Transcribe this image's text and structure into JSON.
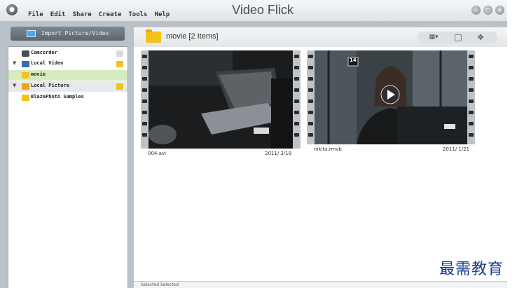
{
  "window": {
    "title": "Video Flick",
    "menu": [
      "File",
      "Edit",
      "Share",
      "Create",
      "Tools",
      "Help"
    ],
    "controls": [
      "minimize-icon",
      "maximize-icon",
      "close-icon"
    ]
  },
  "sidebar": {
    "import_button": "Import Picture/Video",
    "tree": [
      {
        "label": "Camcorder",
        "icon": "camcorder-icon"
      },
      {
        "label": "Local Video",
        "icon": "video-folder-icon"
      },
      {
        "label": "movie",
        "icon": "folder-icon",
        "selected": true
      },
      {
        "label": "Local Picture",
        "icon": "picture-folder-icon"
      },
      {
        "label": "BlazePhoto Samples",
        "icon": "folder-icon"
      }
    ]
  },
  "main": {
    "folder_label": "movie [2 Items]",
    "view_controls": [
      "grid-view-icon",
      "single-view-icon",
      "fullscreen-icon"
    ],
    "items": [
      {
        "name": "004.avi",
        "date": "2011/ 3/18"
      },
      {
        "name": "nikita.rmvb",
        "date": "2011/ 1/21",
        "badge": "14"
      }
    ],
    "status": "Selected Selected"
  },
  "watermark": "最需教育",
  "colors": {
    "app_bg": "#b9c1c9",
    "selected_row": "#d7ecbe",
    "folder": "#f3c11c",
    "watermark": "#1a3c8f"
  }
}
